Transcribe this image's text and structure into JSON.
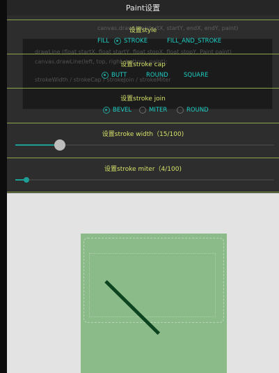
{
  "window": {
    "title": "Paint设置"
  },
  "style_section": {
    "label": "设置style",
    "options": [
      {
        "label": "FILL",
        "selected": false
      },
      {
        "label": "STROKE",
        "selected": true
      },
      {
        "label": "FILL_AND_STROKE",
        "selected": false
      }
    ]
  },
  "cap_section": {
    "label": "设置stroke cap",
    "options": [
      {
        "label": "BUTT",
        "selected": true
      },
      {
        "label": "ROUND",
        "selected": false
      },
      {
        "label": "SQUARE",
        "selected": false
      }
    ]
  },
  "join_section": {
    "label": "设置stroke join",
    "options": [
      {
        "label": "BEVEL",
        "selected": true
      },
      {
        "label": "MITER",
        "selected": false
      },
      {
        "label": "ROUND",
        "selected": false
      }
    ]
  },
  "width_section": {
    "label": "设置stroke width（15/100)",
    "value": 15,
    "max": 100
  },
  "miter_section": {
    "label": "设置stroke miter（4/100)",
    "value": 4,
    "max": 100
  },
  "colors": {
    "accent": "#1d9f96",
    "label_text": "#d7e36a",
    "option_text": "#1ed0c6",
    "divider": "#8ea64a",
    "canvas_fill": "#8cbb8a",
    "stroke_color": "#0d4420"
  },
  "icons": [
    "radio-button-icon",
    "slider-thumb-icon"
  ]
}
